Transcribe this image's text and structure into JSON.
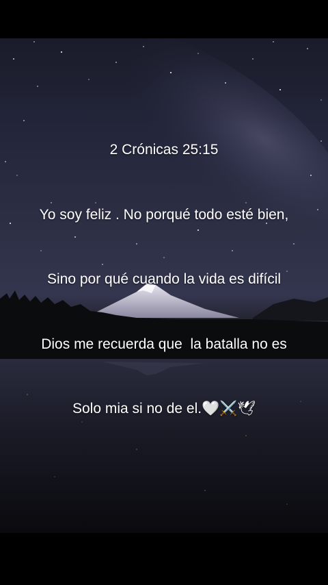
{
  "quote": {
    "reference": "2 Crónicas 25:15",
    "lines": [
      "Yo soy feliz . No porqué todo esté bien,",
      "Sino por qué cuando la vida es difícil",
      "Dios me recuerda que  la batalla no es",
      "Solo mia si no de el.🤍⚔️🕊"
    ]
  },
  "colors": {
    "text": "#ffffff",
    "sky": "#2d2f45",
    "letterbox": "#000000"
  }
}
